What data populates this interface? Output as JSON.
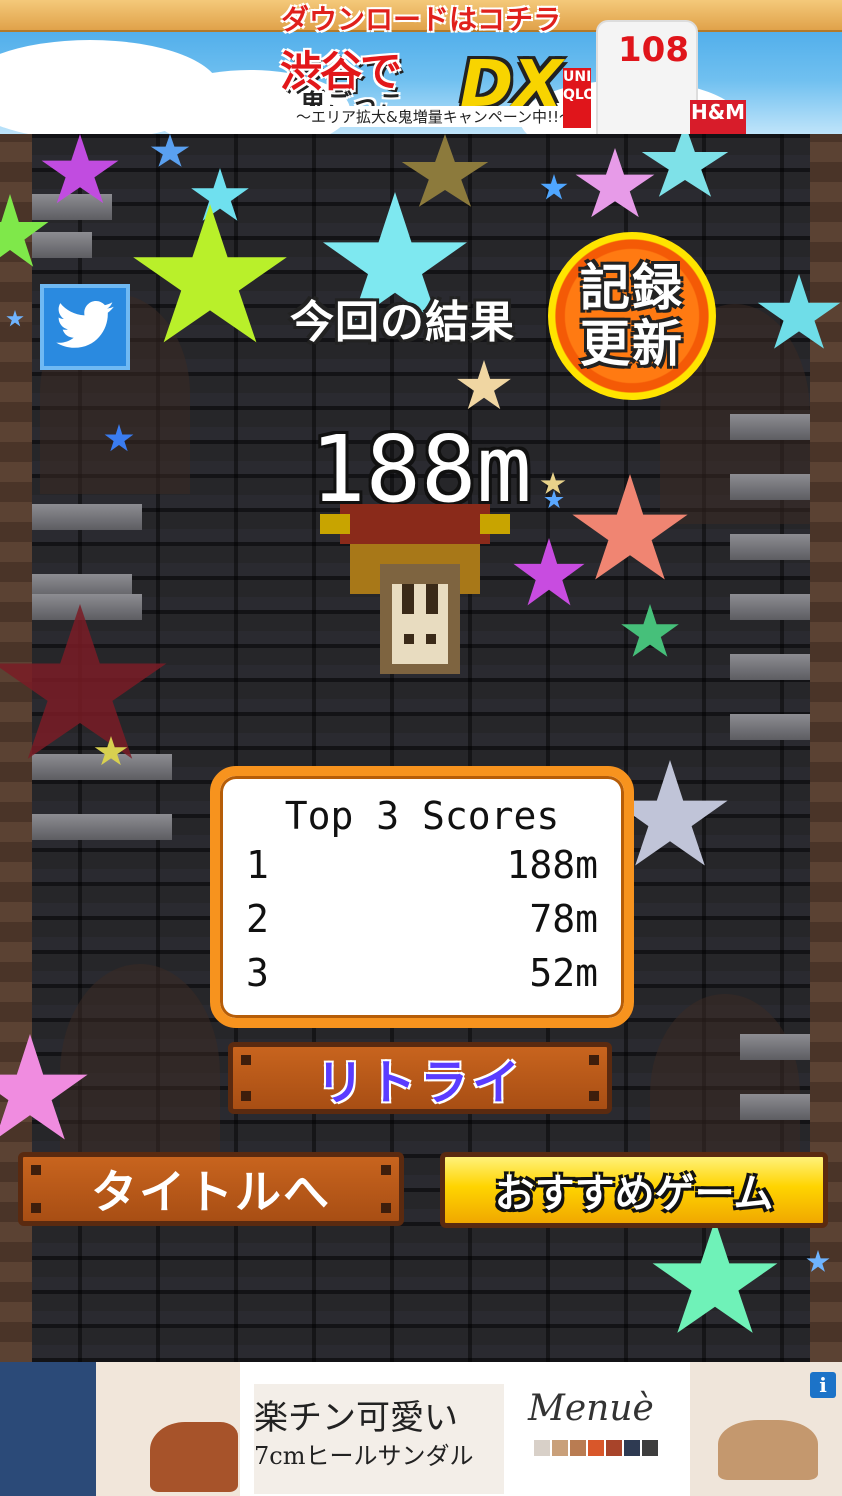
{
  "top_ad": {
    "download_text": "ダウンロードはコチラ",
    "game_title_part1": "渋谷で",
    "game_title_part2": "鬼ごっこ",
    "game_title_dx": "DX",
    "campaign_text": "〜エリア拡大&鬼増量キャンペーン中!!〜",
    "side_number": "108",
    "uniqlo_text": "UNI QLO",
    "hm_text": "H&M"
  },
  "game": {
    "result_label": "今回の結果",
    "record_badge_line1": "記録",
    "record_badge_line2": "更新",
    "score": "188m",
    "scores_panel": {
      "title": "Top 3 Scores",
      "rows": [
        {
          "rank": "1",
          "score": "188m"
        },
        {
          "rank": "2",
          "score": "78m"
        },
        {
          "rank": "3",
          "score": "52m"
        }
      ]
    },
    "retry_label": "リトライ",
    "title_button_label": "タイトルへ",
    "recommend_label": "おすすめゲーム",
    "twitter_icon": "twitter-bird-icon"
  },
  "bottom_ad": {
    "headline": "楽チン可愛い",
    "subline": "7cmヒールサンダル",
    "brand": "Menuè",
    "info_icon": "i",
    "swatch_colors": [
      "#d8d0c8",
      "#c9a07a",
      "#b97c52",
      "#d9572a",
      "#a8442a",
      "#2e3a52",
      "#3e3e3e"
    ]
  }
}
